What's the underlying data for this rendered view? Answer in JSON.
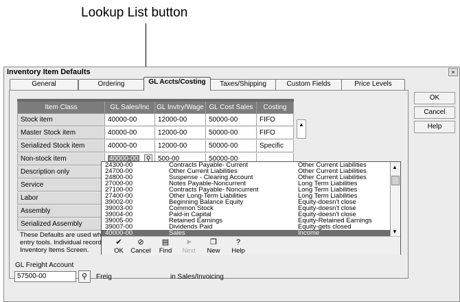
{
  "callout": {
    "label": "Lookup List button"
  },
  "window": {
    "title": "Inventory Item Defaults",
    "close_label": "×"
  },
  "tabs": [
    {
      "label": "General"
    },
    {
      "label": "Ordering"
    },
    {
      "label": "GL Accts/Costing"
    },
    {
      "label": "Taxes/Shipping"
    },
    {
      "label": "Custom Fields"
    },
    {
      "label": "Price Levels"
    }
  ],
  "side_buttons": {
    "ok": "OK",
    "cancel": "Cancel",
    "help": "Help"
  },
  "grid": {
    "headers": [
      "Item Class",
      "GL Sales/Inc",
      "GL Invtry/Wage",
      "GL Cost Sales",
      "Costing"
    ],
    "rows": [
      {
        "class": "Stock item",
        "sales": "40000-00",
        "invtry": "12000-00",
        "cost": "50000-00",
        "costing": "FIFO"
      },
      {
        "class": "Master Stock item",
        "sales": "40000-00",
        "invtry": "12000-00",
        "cost": "50000-00",
        "costing": "FIFO"
      },
      {
        "class": "Serialized Stock item",
        "sales": "40000-00",
        "invtry": "12000-00",
        "cost": "50000-00",
        "costing": "Specific"
      },
      {
        "class": "Non-stock item",
        "sales": "40000-00",
        "invtry": "500-00",
        "cost": "50000-00",
        "costing": ""
      },
      {
        "class": "Description only",
        "sales": "",
        "invtry": "",
        "cost": "",
        "costing": ""
      },
      {
        "class": "Service",
        "sales": "",
        "invtry": "",
        "cost": "",
        "costing": ""
      },
      {
        "class": "Labor",
        "sales": "",
        "invtry": "",
        "cost": "",
        "costing": ""
      },
      {
        "class": "Assembly",
        "sales": "",
        "invtry": "",
        "cost": "",
        "costing": ""
      },
      {
        "class": "Serialized Assembly",
        "sales": "",
        "invtry": "",
        "cost": "",
        "costing": ""
      }
    ]
  },
  "note": "These Defaults are used wh entry tools. Individual record Inventory Items Screen.",
  "freight": {
    "label": "GL Freight Account",
    "value": "57500-00",
    "partial_text": "Freig",
    "note": "in Sales/Invoicing"
  },
  "lookup": {
    "accounts": [
      {
        "id": "24300-00",
        "name": "Contracts Payable- Current",
        "type": "Other Current Liabilities"
      },
      {
        "id": "24700-00",
        "name": "Other Current Liabilities",
        "type": "Other Current Liabilities"
      },
      {
        "id": "24800-00",
        "name": "Suspense - Clearing Account",
        "type": "Other Current Liabilities"
      },
      {
        "id": "27000-00",
        "name": "Notes Payable-Noncurrent",
        "type": "Long Term Liabilities"
      },
      {
        "id": "27100-00",
        "name": "Contracts Payable- Noncurrent",
        "type": "Long Term Liabilities"
      },
      {
        "id": "27400-00",
        "name": "Other Long-Term Liabilities",
        "type": "Long Term Liabilities"
      },
      {
        "id": "39002-00",
        "name": "Beginning Balance Equity",
        "type": "Equity-doesn't close"
      },
      {
        "id": "39003-00",
        "name": "Common Stock",
        "type": "Equity-doesn't close"
      },
      {
        "id": "39004-00",
        "name": "Paid-in Capital",
        "type": "Equity-doesn't close"
      },
      {
        "id": "39005-00",
        "name": "Retained Earnings",
        "type": "Equity-Retained Earnings"
      },
      {
        "id": "39007-00",
        "name": "Dividends Paid",
        "type": "Equity-gets closed"
      },
      {
        "id": "40000-00",
        "name": "Sales",
        "type": "Income"
      }
    ],
    "toolbar": [
      {
        "label": "OK",
        "icon": "✔"
      },
      {
        "label": "Cancel",
        "icon": "⊘"
      },
      {
        "label": "Find",
        "icon": "▤"
      },
      {
        "label": "Next",
        "icon": "➤"
      },
      {
        "label": "New",
        "icon": "❐"
      },
      {
        "label": "Help",
        "icon": "?"
      }
    ]
  }
}
